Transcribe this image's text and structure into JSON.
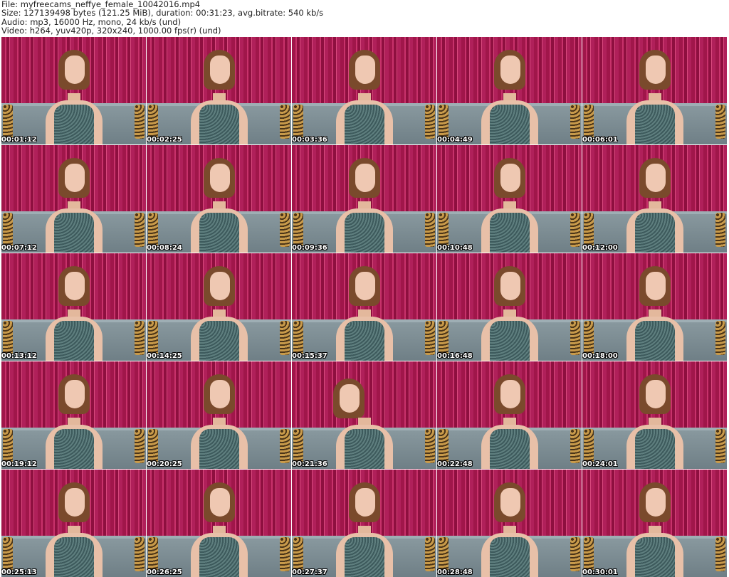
{
  "header": {
    "file": "File: myfreecams_neffye_female_10042016.mp4",
    "size": "Size: 127139498 bytes (121.25 MiB), duration: 00:31:23, avg.bitrate: 540 kb/s",
    "audio": "Audio: mp3, 16000 Hz, mono, 24 kb/s (und)",
    "video": "Video: h264, yuv420p, 320x240, 1000.00 fps(r) (und)"
  },
  "timestamps": [
    "00:01:12",
    "00:02:25",
    "00:03:36",
    "00:04:49",
    "00:06:01",
    "00:07:12",
    "00:08:24",
    "00:09:36",
    "00:10:48",
    "00:12:00",
    "00:13:12",
    "00:14:25",
    "00:15:37",
    "00:16:48",
    "00:18:00",
    "00:19:12",
    "00:20:25",
    "00:21:36",
    "00:22:48",
    "00:24:01",
    "00:25:13",
    "00:26:25",
    "00:27:37",
    "00:28:48",
    "00:30:01"
  ]
}
